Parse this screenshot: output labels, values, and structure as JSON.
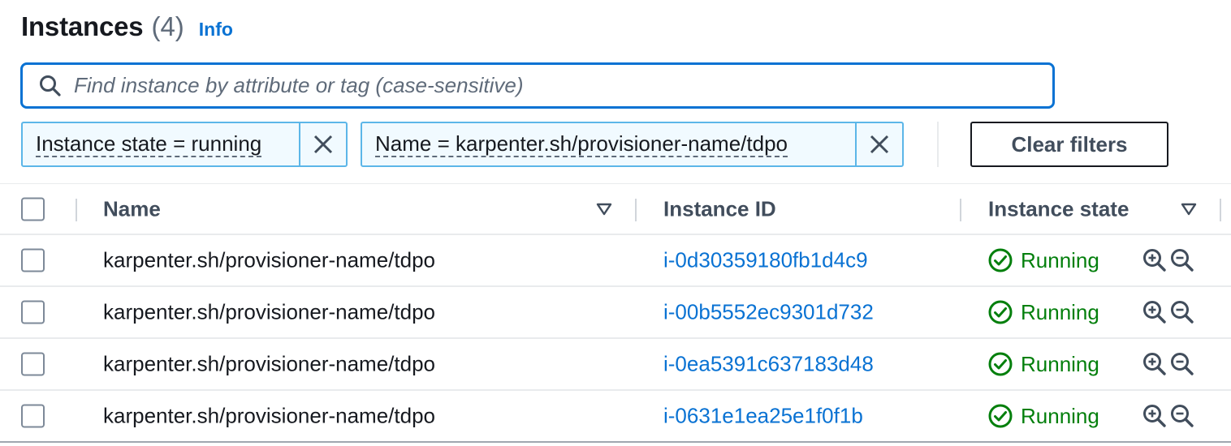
{
  "header": {
    "title": "Instances",
    "count": "(4)",
    "info": "Info"
  },
  "search": {
    "placeholder": "Find instance by attribute or tag (case-sensitive)",
    "value": ""
  },
  "filters": [
    {
      "label": "Instance state = running"
    },
    {
      "label": "Name = karpenter.sh/provisioner-name/tdpo"
    }
  ],
  "clear_filters": "Clear filters",
  "table": {
    "columns": [
      "Name",
      "Instance ID",
      "Instance state"
    ],
    "rows": [
      {
        "name": "karpenter.sh/provisioner-name/tdpo",
        "id": "i-0d30359180fb1d4c9",
        "state": "Running"
      },
      {
        "name": "karpenter.sh/provisioner-name/tdpo",
        "id": "i-00b5552ec9301d732",
        "state": "Running"
      },
      {
        "name": "karpenter.sh/provisioner-name/tdpo",
        "id": "i-0ea5391c637183d48",
        "state": "Running"
      },
      {
        "name": "karpenter.sh/provisioner-name/tdpo",
        "id": "i-0631e1ea25e1f0f1b",
        "state": "Running"
      }
    ]
  },
  "icons": {
    "search": "search-icon",
    "close": "close-icon",
    "sort": "sort-down-icon",
    "status": "check-circle-icon",
    "zoom_in": "zoom-in-icon",
    "zoom_out": "zoom-out-icon"
  },
  "colors": {
    "link": "#0972d3",
    "success": "#037f0c",
    "token_border": "#5cb6e8",
    "token_bg": "#f1faff"
  }
}
